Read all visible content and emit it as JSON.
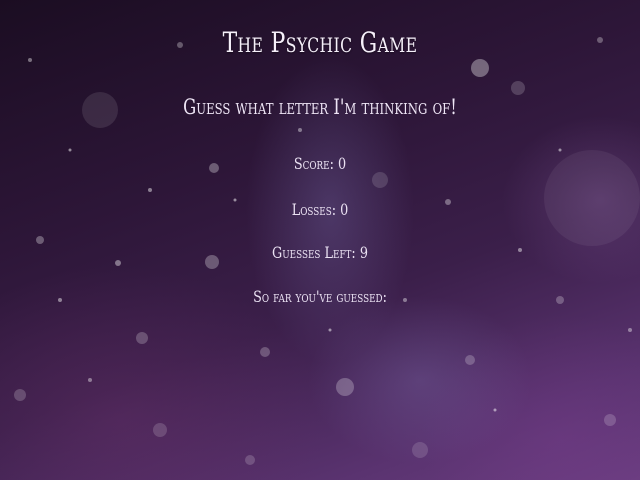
{
  "game": {
    "title": "The Psychic Game",
    "subtitle": "Guess what letter I'm thinking of!",
    "score_label": "Score:",
    "score_value": "0",
    "losses_label": "Losses:",
    "losses_value": "0",
    "guesses_left_label": "Guesses Left:",
    "guesses_left_value": "9",
    "guessed_label": "So far you've guessed:",
    "guessed_letters": ""
  },
  "colors": {
    "background_dark": "#1b0d22",
    "background_mid": "#3b1f4a",
    "background_light": "#6a3d80",
    "text": "#f4eef8"
  }
}
